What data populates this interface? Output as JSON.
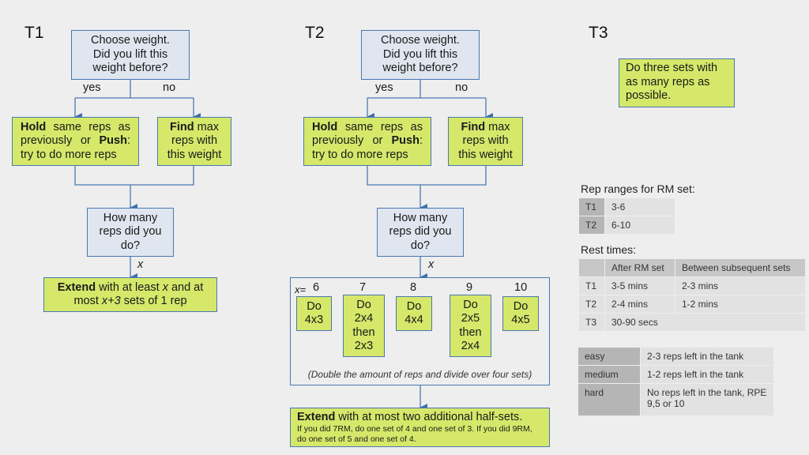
{
  "t1": {
    "title": "T1",
    "question": [
      "Choose weight.",
      "Did you lift this",
      "weight before?"
    ],
    "yes": "yes",
    "no": "no",
    "hold": {
      "bold1": "Hold",
      "text1": " same reps as previously or ",
      "bold2": "Push",
      "text2": ": try to do more reps"
    },
    "find": {
      "bold": "Find",
      "text": " max reps with this weight"
    },
    "how_many": [
      "How many",
      "reps did you",
      "do?"
    ],
    "x_label": "x",
    "extend": {
      "bold": "Extend",
      "t1": " with at least ",
      "x": "x",
      "t2": " and at most ",
      "x3": "x+3",
      "t3": " sets of 1 rep"
    }
  },
  "t2": {
    "title": "T2",
    "question": [
      "Choose weight.",
      "Did you lift this",
      "weight before?"
    ],
    "yes": "yes",
    "no": "no",
    "hold": {
      "bold1": "Hold",
      "text1": " same reps as previously or ",
      "bold2": "Push",
      "text2": ": try to do more reps"
    },
    "find": {
      "bold": "Find",
      "text": " max reps with this weight"
    },
    "how_many": [
      "How many",
      "reps did you",
      "do?"
    ],
    "x_label": "x",
    "x_eq": "x=",
    "options": [
      {
        "x": "6",
        "lines": [
          "Do",
          "4x3"
        ]
      },
      {
        "x": "7",
        "lines": [
          "Do",
          "2x4",
          "then",
          "2x3"
        ]
      },
      {
        "x": "8",
        "lines": [
          "Do",
          "4x4"
        ]
      },
      {
        "x": "9",
        "lines": [
          "Do",
          "2x5",
          "then",
          "2x4"
        ]
      },
      {
        "x": "10",
        "lines": [
          "Do",
          "4x5"
        ]
      }
    ],
    "note": "(Double the amount of reps and divide over four sets)",
    "extend": {
      "bold": "Extend",
      "text": " with at most two additional half-sets.",
      "detail": "If you did 7RM, do one set of 4 and one set of 3. If you did 9RM, do one set of 5 and one set of 4."
    }
  },
  "t3": {
    "title": "T3",
    "box": "Do three sets with as many reps as possible."
  },
  "rep_ranges": {
    "title": "Rep ranges for RM set:",
    "rows": [
      [
        "T1",
        "3-6"
      ],
      [
        "T2",
        "6-10"
      ]
    ]
  },
  "rest_times": {
    "title": "Rest times:",
    "headers": [
      "",
      "After RM set",
      "Between subsequent sets"
    ],
    "rows": [
      [
        "T1",
        "3-5 mins",
        "2-3 mins"
      ],
      [
        "T2",
        "2-4 mins",
        "1-2 mins"
      ],
      [
        "T3",
        "30-90 secs",
        ""
      ]
    ]
  },
  "difficulty": {
    "rows": [
      [
        "easy",
        "2-3 reps left in the tank"
      ],
      [
        "medium",
        "1-2 reps left in the tank"
      ],
      [
        "hard",
        "No reps left in the tank, RPE 9,5 or 10"
      ]
    ]
  },
  "colors": {
    "box_blue": "#dfe6ef",
    "box_green": "#d5e86a",
    "border": "#4a78b0",
    "background": "#eeeeee"
  }
}
